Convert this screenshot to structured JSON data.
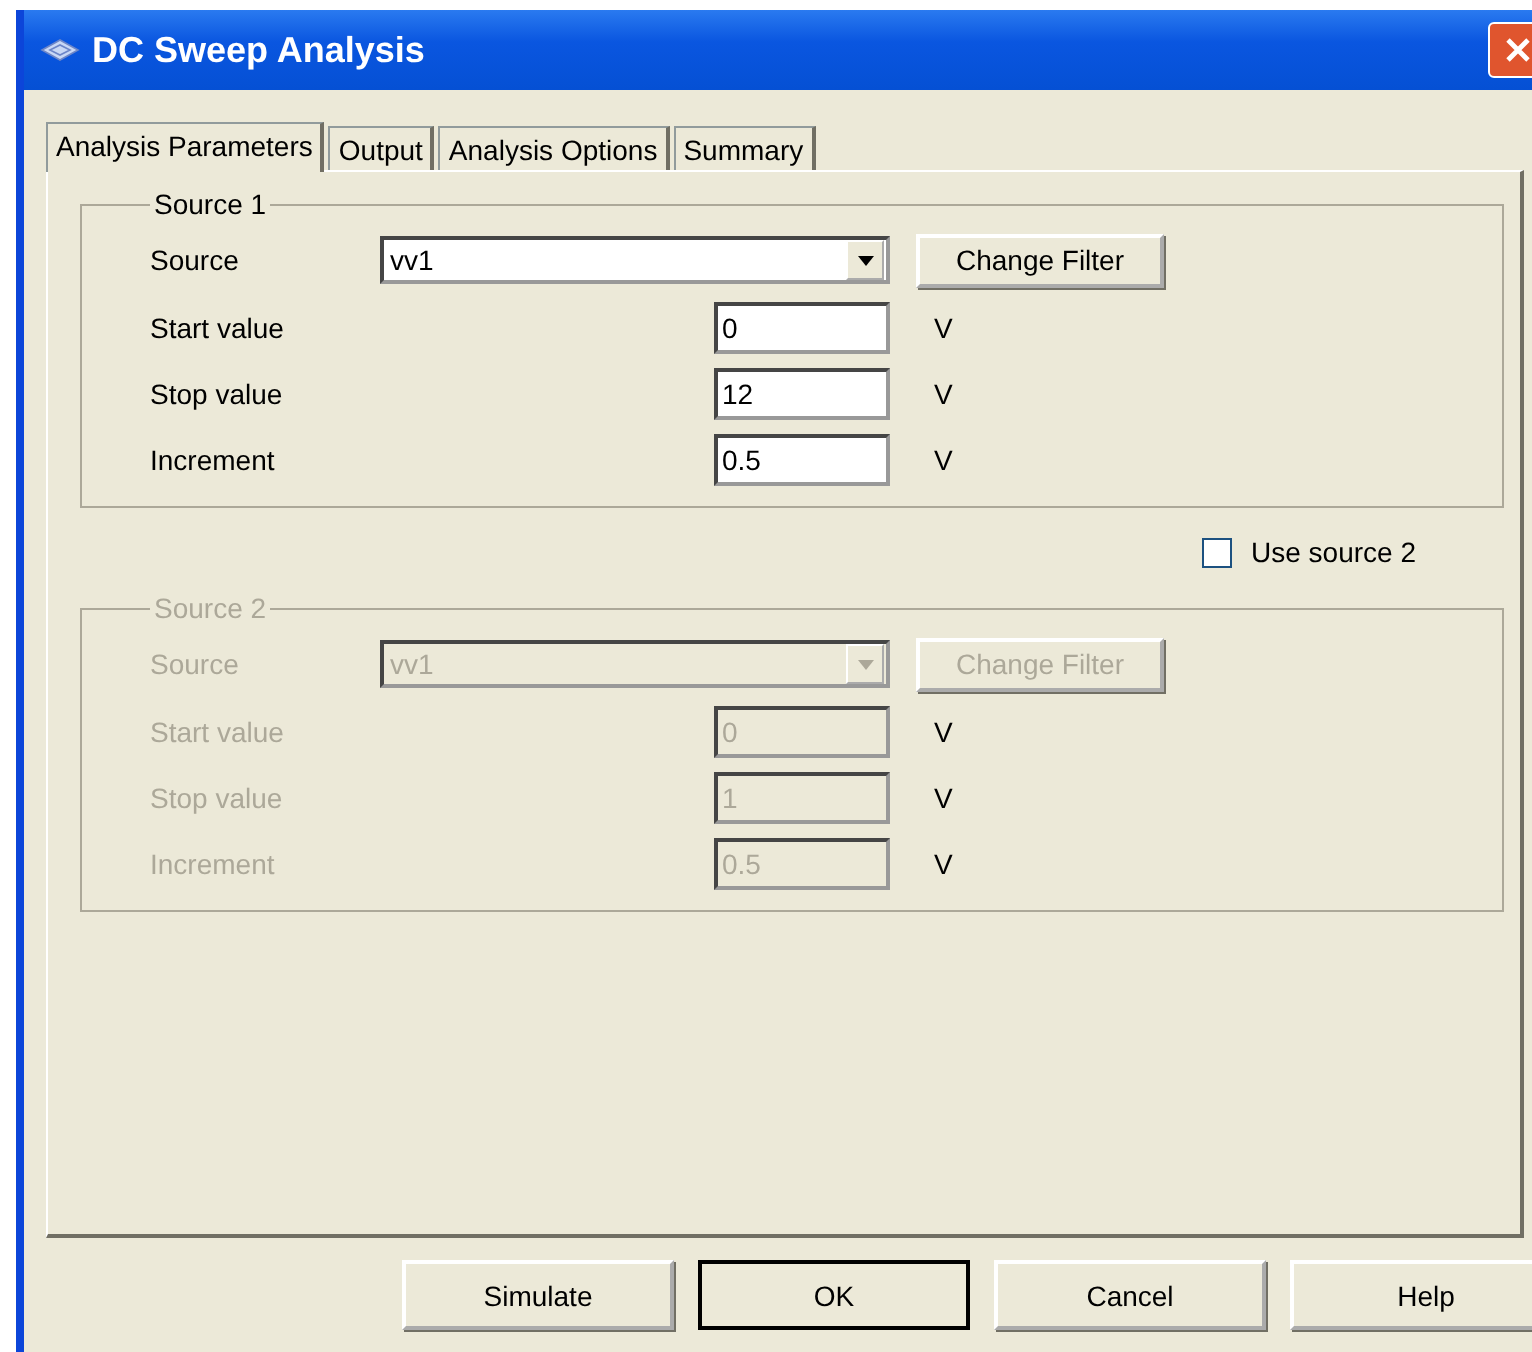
{
  "window": {
    "title": "DC Sweep Analysis"
  },
  "tabs": [
    {
      "label": "Analysis Parameters",
      "selected": true
    },
    {
      "label": "Output",
      "selected": false
    },
    {
      "label": "Analysis Options",
      "selected": false
    },
    {
      "label": "Summary",
      "selected": false
    }
  ],
  "source_groups": [
    {
      "title": "Source 1",
      "disabled": false,
      "source_label": "Source",
      "source_value": "vv1",
      "filter_button": "Change Filter",
      "fields": [
        {
          "label": "Start value",
          "value": "0",
          "unit": "V"
        },
        {
          "label": "Stop value",
          "value": "12",
          "unit": "V"
        },
        {
          "label": "Increment",
          "value": "0.5",
          "unit": "V"
        }
      ]
    },
    {
      "title": "Source 2",
      "disabled": true,
      "source_label": "Source",
      "source_value": "vv1",
      "filter_button": "Change Filter",
      "fields": [
        {
          "label": "Start value",
          "value": "0",
          "unit": "V"
        },
        {
          "label": "Stop value",
          "value": "1",
          "unit": "V"
        },
        {
          "label": "Increment",
          "value": "0.5",
          "unit": "V"
        }
      ]
    }
  ],
  "use_source_2": {
    "label": "Use source 2",
    "checked": false
  },
  "buttons": [
    {
      "label": "Simulate",
      "default": false
    },
    {
      "label": "OK",
      "default": true
    },
    {
      "label": "Cancel",
      "default": false
    },
    {
      "label": "Help",
      "default": false
    }
  ]
}
